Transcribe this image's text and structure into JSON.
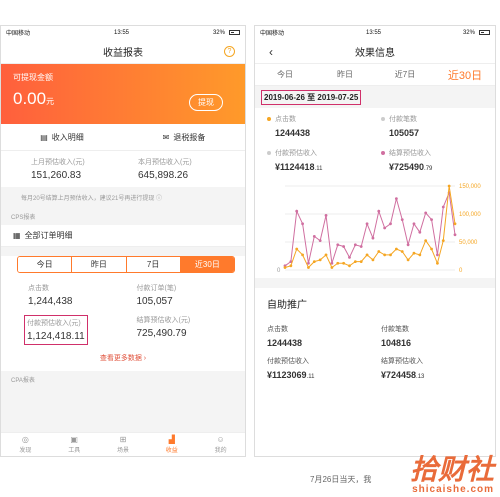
{
  "left": {
    "status": {
      "carrier": "中国移动",
      "time": "13:55",
      "battery": "32%"
    },
    "title": "收益报表",
    "help": "?",
    "withdraw": {
      "label": "可提现金额",
      "amount": "0.00",
      "unit": "元",
      "button": "提现"
    },
    "actions": [
      "收入明细",
      "退税报备"
    ],
    "last_month": {
      "label": "上月预估收入(元)",
      "value": "151,260.83"
    },
    "this_month": {
      "label": "本月预估收入(元)",
      "value": "645,898.26"
    },
    "note": "每月20号结算上月预估收入，建议21号再进行提现",
    "cps": "CPS报表",
    "all_orders": "全部订单明细",
    "segments": [
      "今日",
      "昨日",
      "7日",
      "近30日"
    ],
    "stats": [
      {
        "label": "点击数",
        "value": "1,244,438"
      },
      {
        "label": "付款订单(笔)",
        "value": "105,057"
      },
      {
        "label": "付款预估收入(元)",
        "value": "1,124,418.11"
      },
      {
        "label": "结算预估收入(元)",
        "value": "725,490.79"
      }
    ],
    "more": "查看更多数据",
    "cpa": "CPA报表",
    "tabs": [
      {
        "label": "发现",
        "icon": "discover-icon"
      },
      {
        "label": "工具",
        "icon": "toolbox-icon"
      },
      {
        "label": "场景",
        "icon": "grid-icon"
      },
      {
        "label": "收益",
        "icon": "bar-chart-icon"
      },
      {
        "label": "我的",
        "icon": "user-icon"
      }
    ]
  },
  "right": {
    "status": {
      "carrier": "中国移动",
      "time": "13:55",
      "battery": "32%"
    },
    "title": "效果信息",
    "tabs": [
      "今日",
      "昨日",
      "近7日",
      "近30日"
    ],
    "date_range": "2019-06-26 至 2019-07-25",
    "metrics": [
      {
        "label": "点击数",
        "value": "1244438",
        "color": "#f5a623"
      },
      {
        "label": "付款笔数",
        "value": "105057",
        "color": "#cccccc"
      },
      {
        "label": "付款预估收入",
        "value": "¥1124418",
        "cents": ".11",
        "color": "#cccccc"
      },
      {
        "label": "结算预估收入",
        "value": "¥725490",
        "cents": ".79",
        "color": "#d06fa0"
      }
    ],
    "chart_data": {
      "type": "line",
      "yticks": [
        "150,000",
        "100,000",
        "50,000",
        "0"
      ],
      "series": [
        {
          "values": [
            5,
            10,
            70,
            55,
            8,
            40,
            35,
            65,
            8,
            30,
            28,
            15,
            30,
            28,
            55,
            38,
            70,
            50,
            55,
            85,
            60,
            30,
            55,
            45,
            68,
            60,
            18,
            75,
            92,
            42
          ],
          "color": "#d06fa0"
        },
        {
          "values": [
            3,
            5,
            25,
            18,
            3,
            10,
            12,
            18,
            3,
            8,
            8,
            5,
            10,
            10,
            18,
            12,
            22,
            18,
            18,
            25,
            22,
            12,
            20,
            18,
            35,
            25,
            8,
            35,
            100,
            55
          ],
          "color": "#f5a623"
        }
      ],
      "ylim": [
        0,
        100
      ]
    },
    "promo_title": "自助推广",
    "promo": [
      {
        "label": "点击数",
        "value": "1244438"
      },
      {
        "label": "付款笔数",
        "value": "104816"
      },
      {
        "label": "付款预估收入",
        "value": "¥1123069",
        "cents": ".11"
      },
      {
        "label": "结算预估收入",
        "value": "¥724458",
        "cents": ".13"
      }
    ]
  },
  "caption": "7月26日当天，我",
  "watermark": {
    "a": "拾财社",
    "b": "shicaishe.com"
  }
}
